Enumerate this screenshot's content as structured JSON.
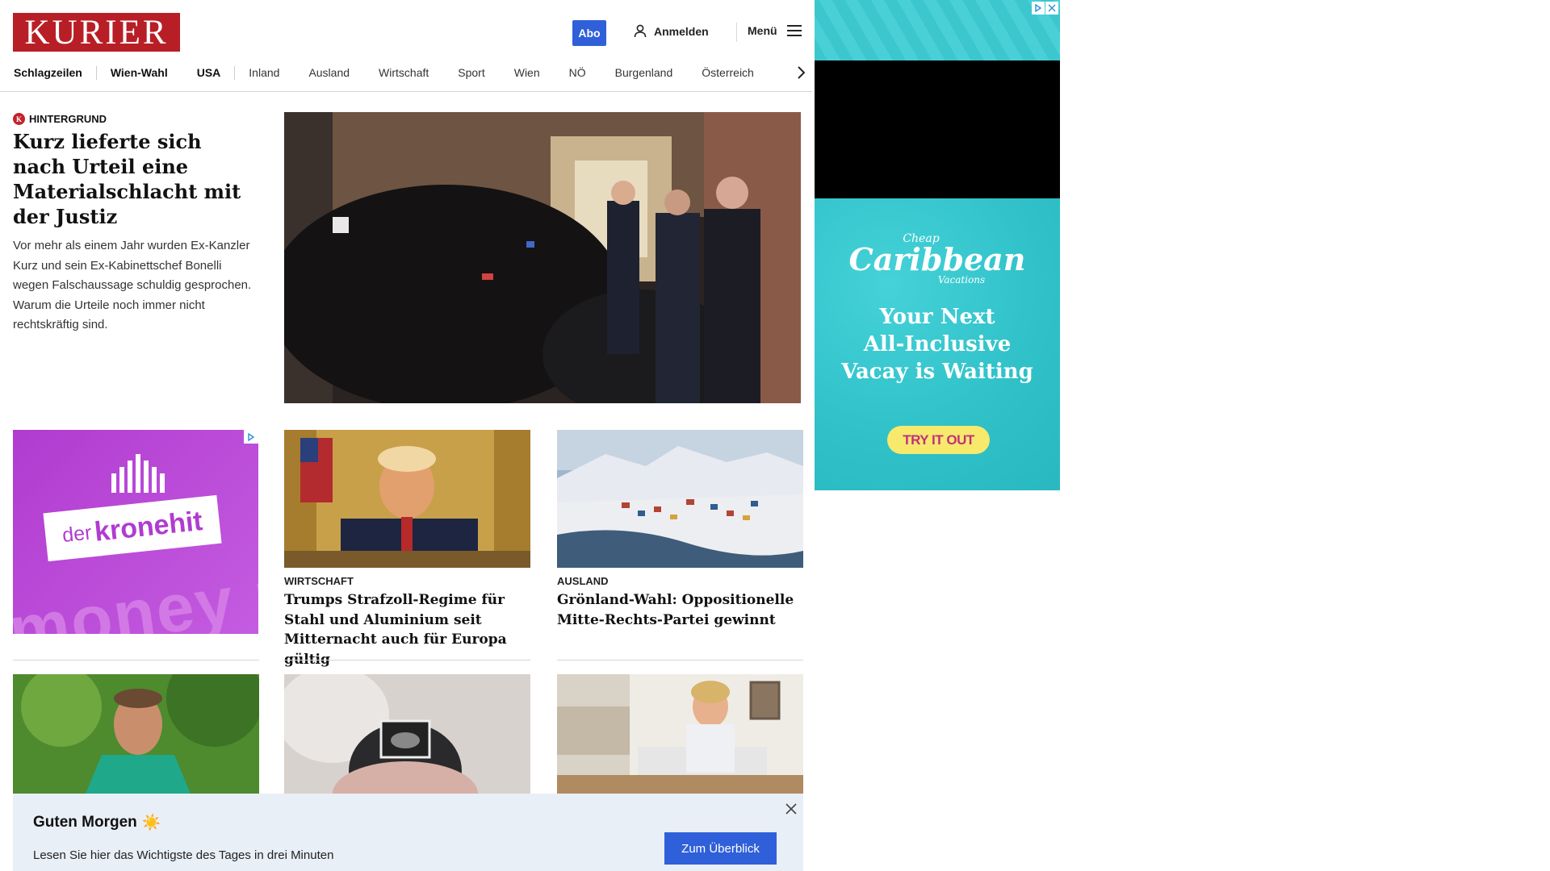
{
  "header": {
    "logo_text": "KURIER",
    "abo_label": "Abo",
    "login_label": "Anmelden",
    "menu_label": "Menü"
  },
  "nav": {
    "items": [
      "Schlagzeilen",
      "Wien-Wahl",
      "USA",
      "Inland",
      "Ausland",
      "Wirtschaft",
      "Sport",
      "Wien",
      "NÖ",
      "Burgenland",
      "Österreich"
    ]
  },
  "hero": {
    "kicker": "HINTERGRUND",
    "title": "Kurz lieferte sich nach Urteil eine Materialschlacht mit der Justiz",
    "teaser": "Vor mehr als einem Jahr wurden Ex-Kanzler Kurz und sein Ex-Kabinettschef Bonelli wegen Falschaussage schuldig gesprochen. Warum die Urteile noch immer nicht rechtskräftig sind."
  },
  "ads": {
    "kronehit_left": "der",
    "kronehit_right": "kronehit",
    "kronehit_bg_text": "money m",
    "caribbean_cheap": "Cheap",
    "caribbean_brand": "Caribbean",
    "caribbean_vacations": "Vacations",
    "caribbean_headline_1": "Your Next",
    "caribbean_headline_2": "All-Inclusive",
    "caribbean_headline_3": "Vacay is Waiting",
    "caribbean_cta": "TRY IT OUT"
  },
  "cards": [
    {
      "kicker": "WIRTSCHAFT",
      "title": "Trumps Strafzoll-Regime für Stahl und Aluminium seit Mitternacht auch für Europa gültig"
    },
    {
      "kicker": "AUSLAND",
      "title": "Grönland-Wahl: Oppositionelle Mitte-Rechts-Partei gewinnt"
    }
  ],
  "morning": {
    "title": "Guten Morgen",
    "emoji": "☀️",
    "subtitle": "Lesen Sie hier das Wichtigste des Tages in drei Minuten",
    "button": "Zum Überblick"
  },
  "colors": {
    "brand_red": "#b81e26",
    "accent_blue": "#2f60d9",
    "morning_bg": "#e9eff7"
  }
}
